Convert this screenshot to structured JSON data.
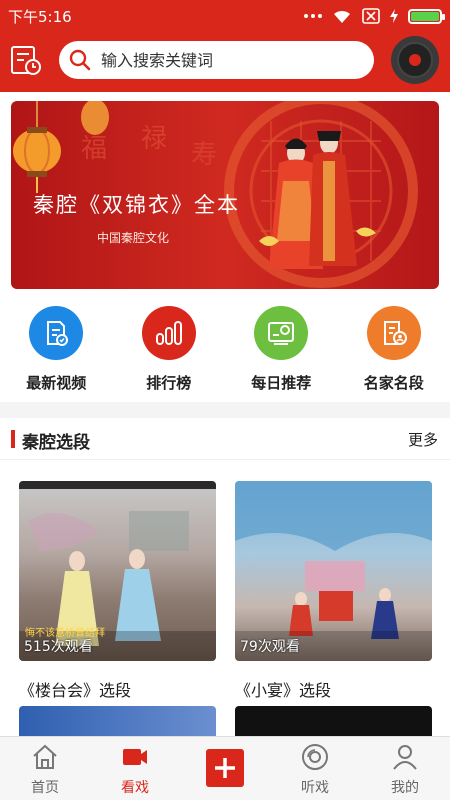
{
  "status_bar": {
    "time": "下午5:16"
  },
  "header": {
    "search_placeholder": "输入搜索关键词"
  },
  "banner": {
    "title": "秦腔《双锦衣》全本",
    "subtitle": "中国秦腔文化"
  },
  "quick_nav": [
    {
      "label": "最新视频",
      "icon": "video-document-icon",
      "color": "#1e88e5"
    },
    {
      "label": "排行榜",
      "icon": "bar-chart-icon",
      "color": "#d9281b"
    },
    {
      "label": "每日推荐",
      "icon": "recommend-card-icon",
      "color": "#6cbf3f"
    },
    {
      "label": "名家名段",
      "icon": "profile-document-icon",
      "color": "#ef7c2a"
    }
  ],
  "section": {
    "title": "秦腔选段",
    "more_label": "更多",
    "items": [
      {
        "name": "《楼台会》选段",
        "views": "515次观看"
      },
      {
        "name": "《小宴》选段",
        "views": "79次观看"
      }
    ]
  },
  "tabbar": [
    {
      "label": "首页",
      "icon": "home-icon",
      "active": false
    },
    {
      "label": "看戏",
      "icon": "video-camera-icon",
      "active": true
    },
    {
      "label": "",
      "icon": "plus-icon",
      "active": false
    },
    {
      "label": "听戏",
      "icon": "disc-icon",
      "active": false
    },
    {
      "label": "我的",
      "icon": "user-icon",
      "active": false
    }
  ],
  "colors": {
    "brand": "#d9281b"
  }
}
